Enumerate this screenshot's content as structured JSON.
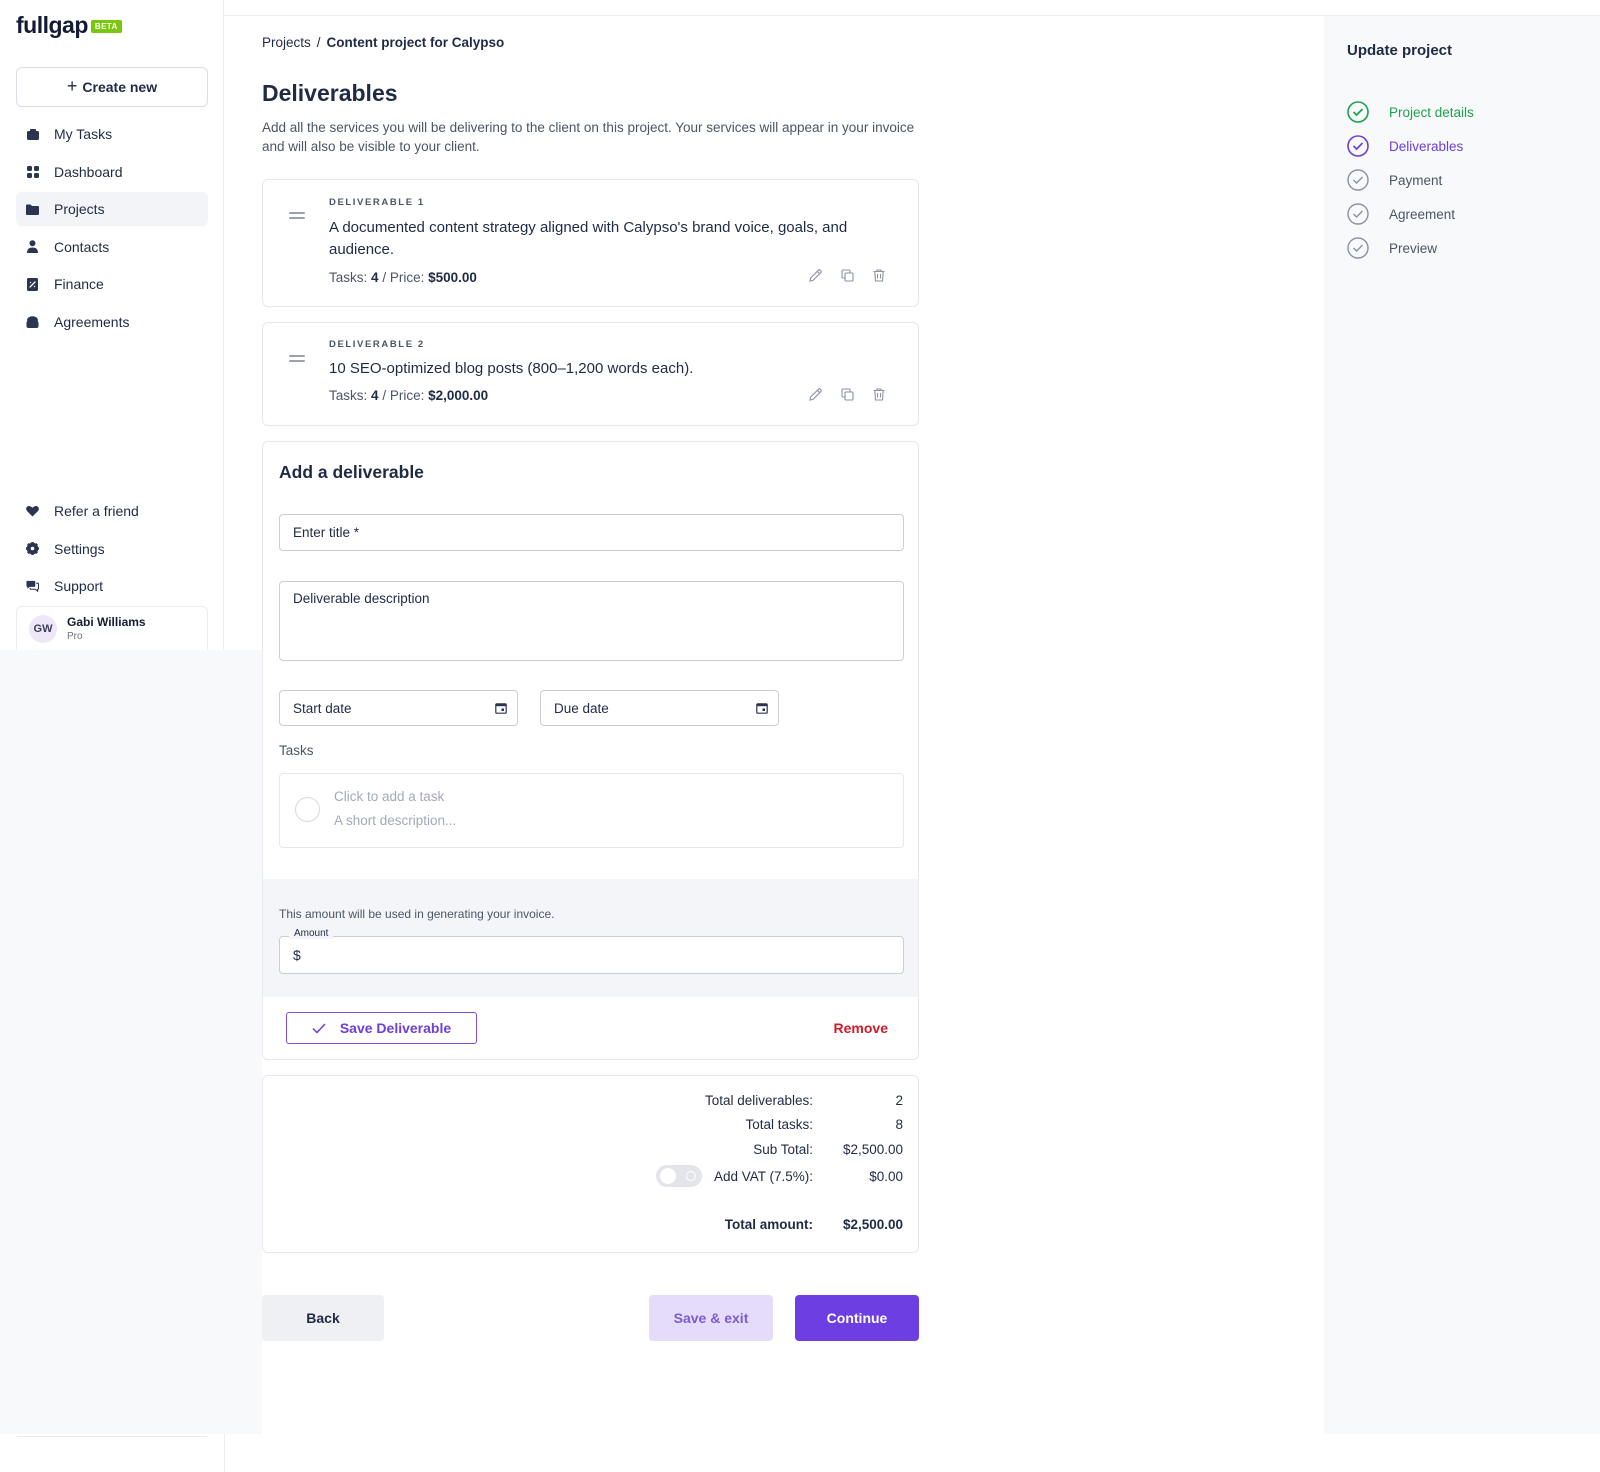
{
  "brand": {
    "name": "fullgap",
    "badge": "BETA",
    "badge_color": "#7ac70c"
  },
  "sidebar": {
    "create_label": "Create new",
    "items": [
      {
        "label": "My Tasks",
        "icon": "tasks-icon"
      },
      {
        "label": "Dashboard",
        "icon": "dashboard-icon"
      },
      {
        "label": "Projects",
        "icon": "folder-icon",
        "active": true
      },
      {
        "label": "Contacts",
        "icon": "user-icon"
      },
      {
        "label": "Finance",
        "icon": "receipt-icon"
      },
      {
        "label": "Agreements",
        "icon": "agreement-icon"
      }
    ],
    "bottom_items": [
      {
        "label": "Refer a friend",
        "icon": "heart-icon"
      },
      {
        "label": "Settings",
        "icon": "gear-icon"
      },
      {
        "label": "Support",
        "icon": "chat-icon"
      }
    ],
    "user": {
      "initials": "GW",
      "name": "Gabi Williams",
      "plan": "Pro"
    }
  },
  "breadcrumb": {
    "root": "Projects",
    "separator": "/",
    "current": "Content project for Calypso"
  },
  "page": {
    "title": "Deliverables",
    "description": "Add all the services you will be delivering to the client on this project. Your services will appear in your invoice and will also be visible to your client."
  },
  "deliverables": [
    {
      "label": "DELIVERABLE 1",
      "description": "A documented content strategy aligned with Calypso's brand voice, goals, and audience.",
      "tasks_label": "Tasks:",
      "tasks": "4",
      "price_label": "/ Price:",
      "price": "$500.00"
    },
    {
      "label": "DELIVERABLE 2",
      "description": "10 SEO-optimized blog posts (800–1,200 words each).",
      "tasks_label": "Tasks:",
      "tasks": "4",
      "price_label": "/ Price:",
      "price": "$2,000.00"
    }
  ],
  "add_form": {
    "title": "Add a deliverable",
    "title_placeholder": "Enter title *",
    "description_placeholder": "Deliverable description",
    "start_date_placeholder": "Start date",
    "due_date_placeholder": "Due date",
    "tasks_label": "Tasks",
    "task_placeholder": "Click to add a task",
    "task_desc_placeholder": "A short description...",
    "amount_note": "This amount will be used in generating your invoice.",
    "amount_label": "Amount",
    "currency_symbol": "$",
    "save_label": "Save Deliverable",
    "remove_label": "Remove"
  },
  "totals": {
    "deliverables_label": "Total deliverables:",
    "deliverables_value": "2",
    "tasks_label": "Total tasks:",
    "tasks_value": "8",
    "subtotal_label": "Sub Total:",
    "subtotal_value": "$2,500.00",
    "vat_label": "Add VAT (7.5%):",
    "vat_value": "$0.00",
    "vat_enabled": false,
    "total_label": "Total amount:",
    "total_value": "$2,500.00"
  },
  "footer_buttons": {
    "back": "Back",
    "save_exit": "Save & exit",
    "continue": "Continue"
  },
  "right_panel": {
    "title": "Update project",
    "steps": [
      {
        "label": "Project details",
        "state": "done"
      },
      {
        "label": "Deliverables",
        "state": "current"
      },
      {
        "label": "Payment",
        "state": "pending"
      },
      {
        "label": "Agreement",
        "state": "pending"
      },
      {
        "label": "Preview",
        "state": "pending"
      }
    ]
  },
  "colors": {
    "accent": "#6d3fe2",
    "success": "#1ea14a",
    "danger": "#d11a2a",
    "text": "#1f2a44"
  }
}
